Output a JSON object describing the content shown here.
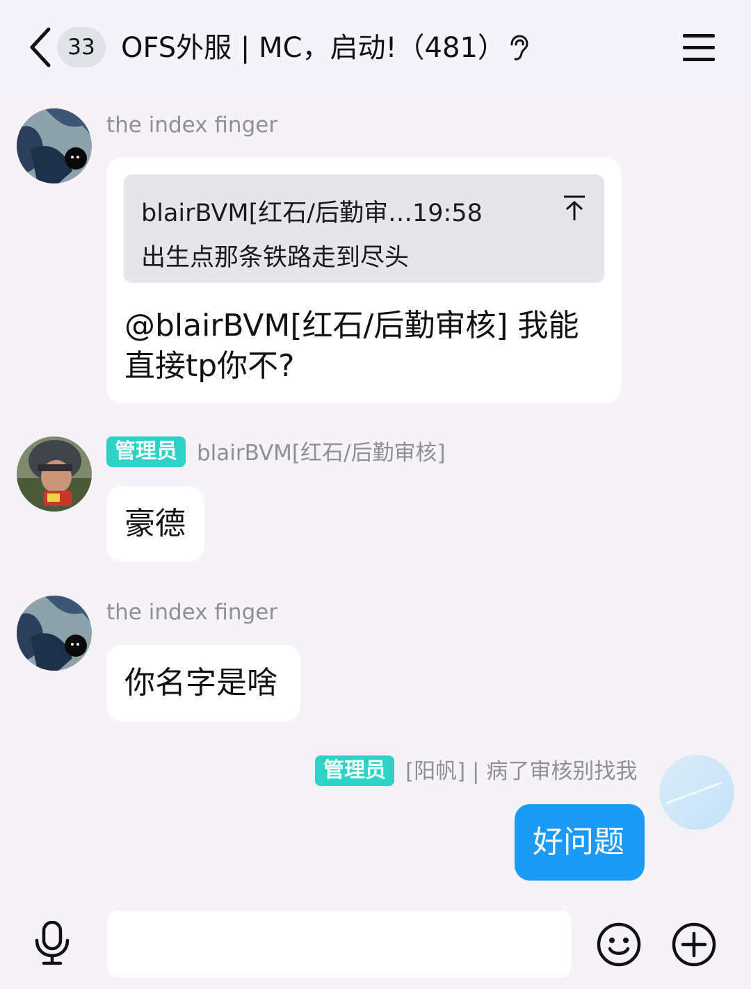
{
  "header": {
    "unread_count": "33",
    "group_title": "OFS外服 | MC，启动!（481）",
    "back_icon": "chevron-left-icon",
    "listen_icon": "ear-icon",
    "menu_icon": "hamburger-menu-icon"
  },
  "messages": [
    {
      "sender": "the index finger",
      "reply": {
        "quoted_sender_time": "blairBVM[红石/后勤审…19:58",
        "quoted_text": "出生点那条铁路走到尽头"
      },
      "text_line1": "@blairBVM[红石/后勤审核] 我能",
      "text_line2": "直接tp你不?"
    },
    {
      "role_tag": "管理员",
      "sender": "blairBVM[红石/后勤审核]",
      "text": "豪德"
    },
    {
      "sender": "the index finger",
      "text": "你名字是啥"
    },
    {
      "role_tag": "管理员",
      "sender": "[阳帆] | 病了审核别找我",
      "text": "好问题"
    }
  ],
  "input_bar": {
    "placeholder": "",
    "mic_icon": "microphone-icon",
    "emoji_icon": "smiley-icon",
    "plus_icon": "plus-circle-icon"
  },
  "colors": {
    "accent_bubble": "#1b9af7",
    "admin_tag": "#2dd2c4",
    "background": "#f5f3f8"
  }
}
